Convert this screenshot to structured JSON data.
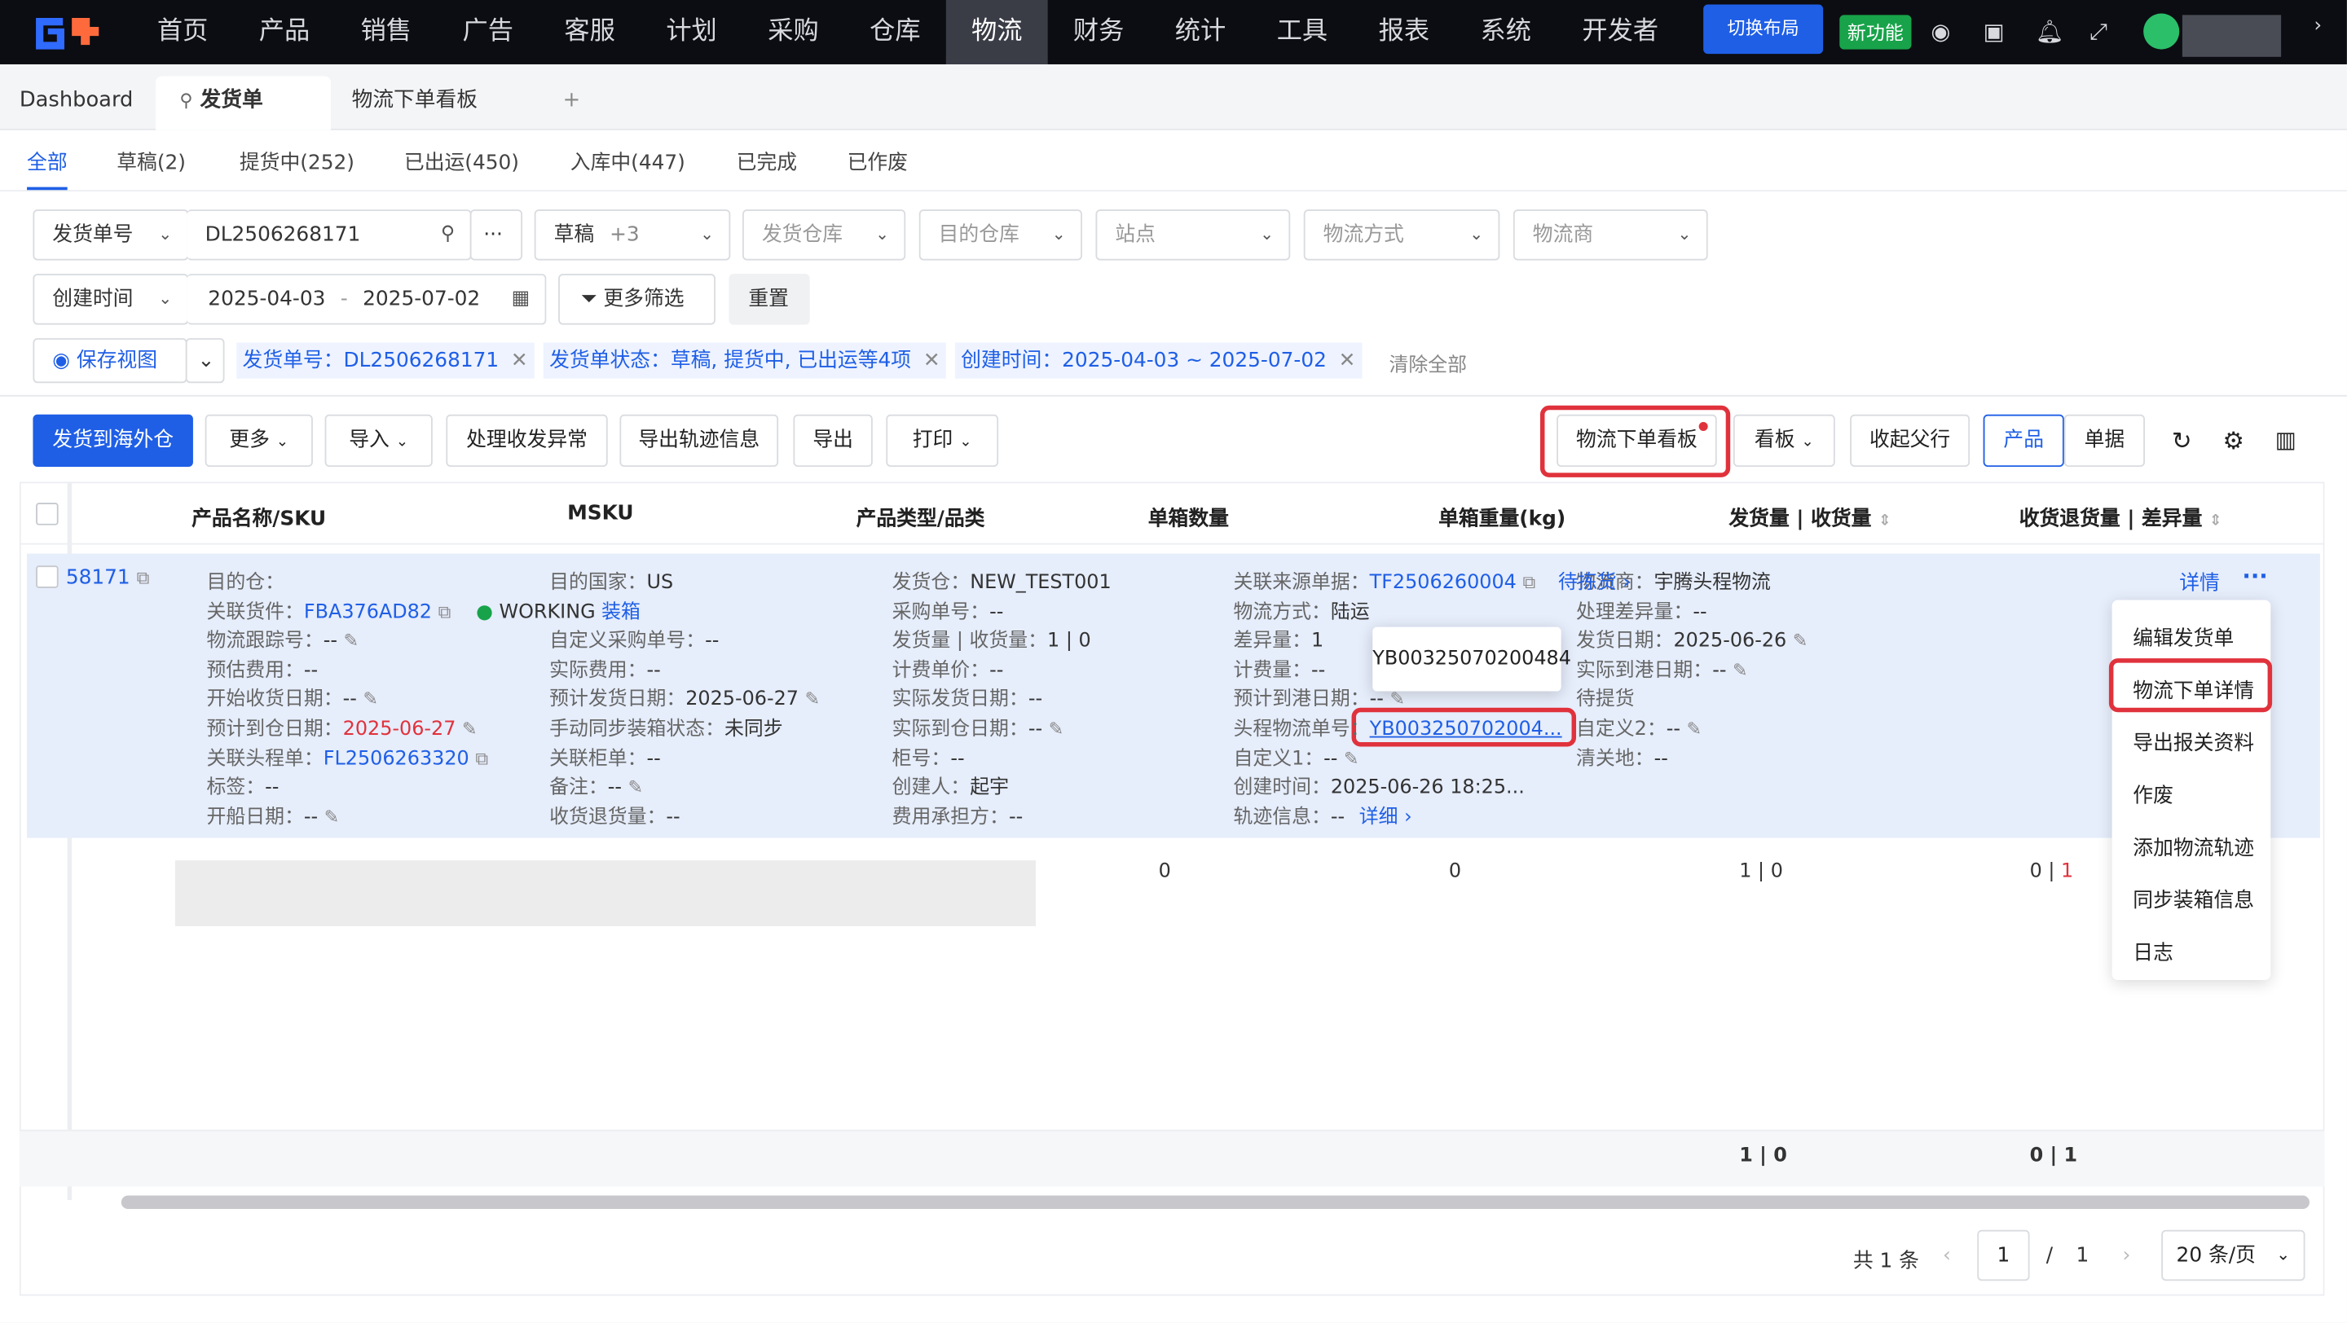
{
  "nav": {
    "items": [
      "首页",
      "产品",
      "销售",
      "广告",
      "客服",
      "计划",
      "采购",
      "仓库",
      "物流",
      "财务",
      "统计",
      "工具",
      "报表",
      "系统",
      "开发者"
    ],
    "switch_label": "切换布局",
    "new_label": "新功能"
  },
  "tabs": {
    "dashboard": "Dashboard",
    "active": "发货单",
    "board": "物流下单看板",
    "plus": "+"
  },
  "status_tabs": [
    "全部",
    "草稿(2)",
    "提货中(252)",
    "已出运(450)",
    "入库中(447)",
    "已完成",
    "已作废"
  ],
  "filters": {
    "field": "发货单号",
    "value": "DL2506268171",
    "more": "···",
    "status": "草稿",
    "status_more": "+3",
    "warehouse": "发货仓库",
    "dest": "目的仓库",
    "site": "站点",
    "method": "物流方式",
    "carrier": "物流商",
    "date_field": "创建时间",
    "date_from": "2025-04-03",
    "date_sep": "-",
    "date_to": "2025-07-02",
    "more_filter": "更多筛选",
    "reset": "重置"
  },
  "chips": {
    "save_view": "保存视图",
    "c1": "发货单号：DL2506268171",
    "c2": "发货单状态：草稿, 提货中, 已出运等4项",
    "c3": "创建时间：2025-04-03 ~ 2025-07-02",
    "clear": "清除全部"
  },
  "toolbar": {
    "ship": "发货到海外仓",
    "more": "更多",
    "import": "导入",
    "exception": "处理收发异常",
    "export_track": "导出轨迹信息",
    "export": "导出",
    "print": "打印",
    "board": "物流下单看板",
    "kanban": "看板",
    "collapse": "收起父行",
    "product": "产品",
    "doc": "单据"
  },
  "columns": [
    "产品名称/SKU",
    "MSKU",
    "产品类型/品类",
    "单箱数量",
    "单箱重量(kg)",
    "发货量 | 收货量",
    "收货退货量 | 差异量"
  ],
  "row": {
    "id": "58171",
    "c1": [
      [
        "目的仓：",
        ""
      ],
      [
        "关联货件：",
        "FBA376AD82"
      ],
      [
        "物流跟踪号：",
        "--"
      ],
      [
        "预估费用：",
        "--"
      ],
      [
        "开始收货日期：",
        "--"
      ],
      [
        "预计到仓日期：",
        "2025-06-27"
      ],
      [
        "关联头程单：",
        "FL2506263320"
      ],
      [
        "标签：",
        "--"
      ],
      [
        "开船日期：",
        "--"
      ]
    ],
    "working": "WORKING",
    "packing": "装箱",
    "c2": [
      [
        "目的国家：",
        "US"
      ],
      [
        "",
        ""
      ],
      [
        "自定义采购单号：",
        "--"
      ],
      [
        "实际费用：",
        "--"
      ],
      [
        "预计发货日期：",
        "2025-06-27"
      ],
      [
        "手动同步装箱状态：",
        "未同步"
      ],
      [
        "关联柜单：",
        "--"
      ],
      [
        "备注：",
        "--"
      ],
      [
        "收货退货量：",
        "--"
      ]
    ],
    "c3": [
      [
        "发货仓：",
        "NEW_TEST001"
      ],
      [
        "采购单号：",
        "--"
      ],
      [
        "发货量 | 收货量：",
        "1 | 0"
      ],
      [
        "计费单价：",
        "--"
      ],
      [
        "实际发货日期：",
        "--"
      ],
      [
        "实际到仓日期：",
        "--"
      ],
      [
        "柜号：",
        "--"
      ],
      [
        "创建人：",
        "起宇"
      ],
      [
        "费用承担方：",
        "--"
      ]
    ],
    "c4": [
      [
        "关联来源单据：",
        "TF2506260004"
      ],
      [
        "物流方式：",
        "陆运"
      ],
      [
        "差异量：",
        "1"
      ],
      [
        "计费量：",
        "--"
      ],
      [
        "预计到港日期：",
        "--"
      ],
      [
        "头程物流单号：",
        "YB003250702004..."
      ],
      [
        "自定义1：",
        "--"
      ],
      [
        "创建时间：",
        "2025-06-26 18:25..."
      ],
      [
        "轨迹信息：",
        "--"
      ]
    ],
    "pick": "待拣货",
    "detail_link": "详细",
    "c5": [
      [
        "物流商：",
        "宇腾头程物流"
      ],
      [
        "处理差异量：",
        "--"
      ],
      [
        "发货日期：",
        "2025-06-26"
      ],
      [
        "实际到港日期：",
        "--"
      ],
      [
        "待提货",
        ""
      ],
      [
        "自定义2：",
        "--"
      ],
      [
        "清关地：",
        "--"
      ]
    ],
    "detail": "详情",
    "more": "···"
  },
  "tooltip": "YB00325070200484",
  "menu": [
    "编辑发货单",
    "物流下单详情",
    "导出报关资料",
    "作废",
    "添加物流轨迹",
    "同步装箱信息",
    "日志"
  ],
  "subrow": {
    "q": "0",
    "w": "0",
    "ship": "1",
    "sep": "|",
    "recv": "0",
    "ret": "0",
    "diff": "1"
  },
  "totals": {
    "ship": "1 | 0",
    "ret": "0 | 1"
  },
  "pager": {
    "total": "共 1 条",
    "page": "1",
    "slash": "/",
    "pages": "1",
    "size": "20 条/页"
  }
}
